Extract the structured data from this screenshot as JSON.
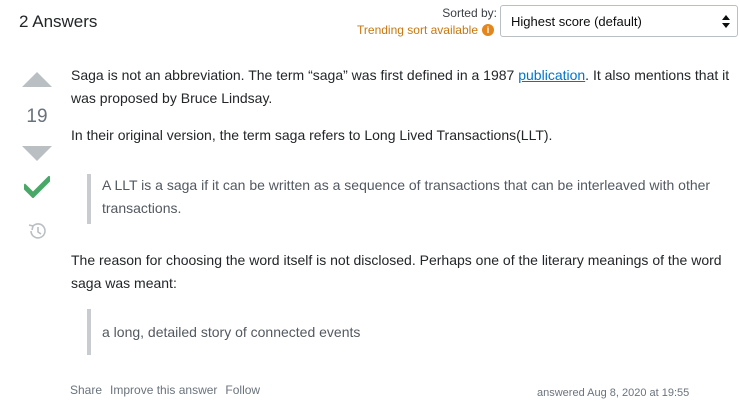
{
  "header": {
    "answers_count_label": "2 Answers",
    "sorted_by_label": "Sorted by:",
    "trending_label": "Trending sort available",
    "sort_selected": "Highest score (default)"
  },
  "vote": {
    "score": "19"
  },
  "answer": {
    "p1_before_link": "Saga is not an abbreviation. The term “saga” was first defined in a 1987 ",
    "p1_link": "publication",
    "p1_after_link": ". It also mentions that it was proposed by Bruce Lindsay.",
    "p2": "In their original version, the term saga refers to Long Lived Transactions(LLT).",
    "quote1": "A LLT is a saga if it can be written as a sequence of transactions that can be interleaved with other transactions.",
    "p3": "The reason for choosing the word itself is not disclosed. Perhaps one of the literary meanings of the word saga was meant:",
    "quote2": "a long, detailed story of connected events"
  },
  "post_menu": {
    "share": "Share",
    "improve": "Improve this answer",
    "follow": "Follow"
  },
  "signature": {
    "answered": "answered Aug 8, 2020 at 19:55"
  },
  "colors": {
    "accepted": "#48a868",
    "trending": "#c8770e",
    "link": "#0074cc"
  }
}
